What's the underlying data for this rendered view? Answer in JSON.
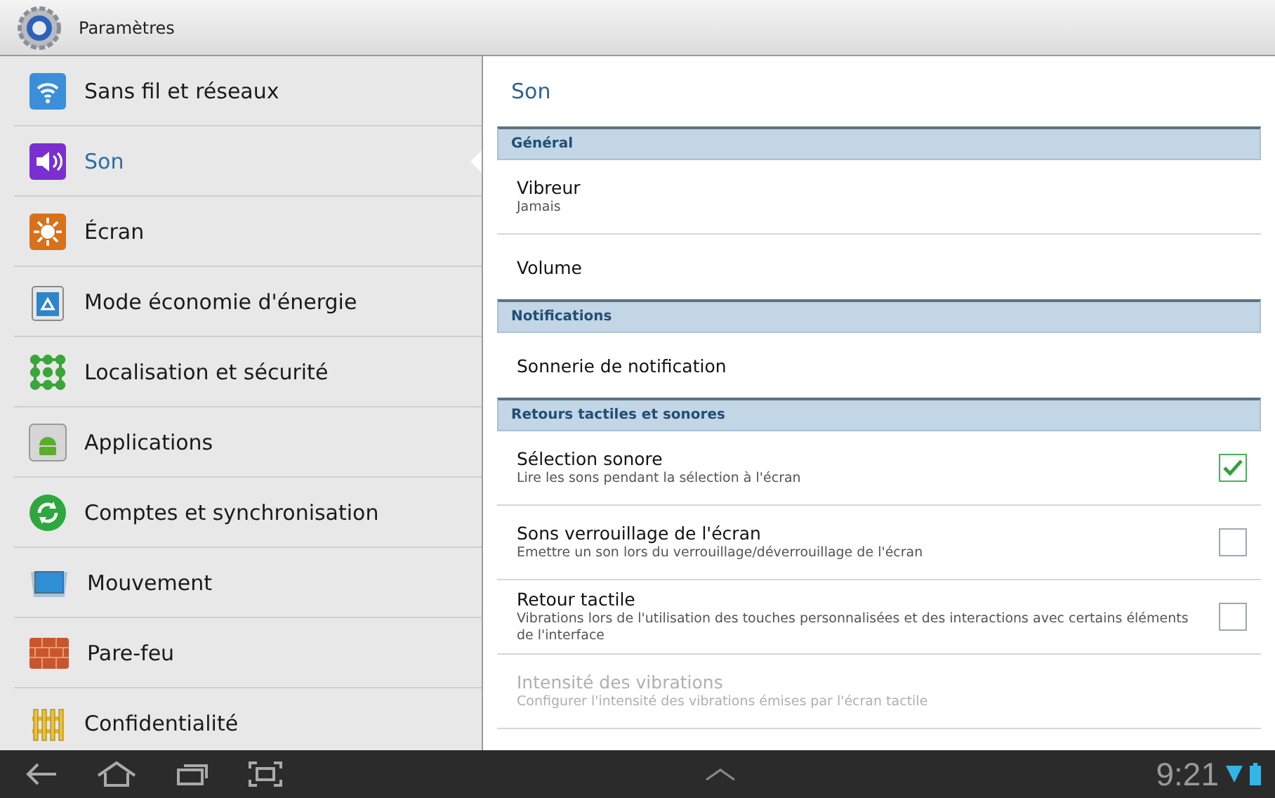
{
  "window": {
    "title": "Paramètres"
  },
  "sidebar": {
    "items": [
      {
        "label": "Sans fil et réseaux",
        "selected": false
      },
      {
        "label": "Son",
        "selected": true
      },
      {
        "label": "Écran",
        "selected": false
      },
      {
        "label": "Mode économie d'énergie",
        "selected": false
      },
      {
        "label": "Localisation et sécurité",
        "selected": false
      },
      {
        "label": "Applications",
        "selected": false
      },
      {
        "label": "Comptes et synchronisation",
        "selected": false
      },
      {
        "label": "Mouvement",
        "selected": false
      },
      {
        "label": "Pare-feu",
        "selected": false
      },
      {
        "label": "Confidentialité",
        "selected": false
      }
    ]
  },
  "panel": {
    "title": "Son",
    "sections": [
      {
        "header": "Général",
        "rows": [
          {
            "kind": "plain",
            "title": "Vibreur",
            "summary": "Jamais",
            "disabled": false
          },
          {
            "kind": "plain",
            "title": "Volume",
            "disabled": false
          }
        ]
      },
      {
        "header": "Notifications",
        "rows": [
          {
            "kind": "plain",
            "title": "Sonnerie de notification",
            "disabled": false
          }
        ]
      },
      {
        "header": "Retours tactiles et sonores",
        "rows": [
          {
            "kind": "checkbox",
            "title": "Sélection sonore",
            "summary": "Lire les sons pendant la sélection à l'écran",
            "checked": true,
            "disabled": false
          },
          {
            "kind": "checkbox",
            "title": "Sons verrouillage de l'écran",
            "summary": "Emettre un son lors du verrouillage/déverrouillage de l'écran",
            "checked": false,
            "disabled": false
          },
          {
            "kind": "checkbox",
            "title": "Retour tactile",
            "summary": "Vibrations lors de l'utilisation des touches personnalisées et des interactions avec certains éléments de l'interface",
            "checked": false,
            "disabled": false
          },
          {
            "kind": "plain",
            "title": "Intensité des vibrations",
            "summary": "Configurer l'intensité des vibrations émises par l'écran tactile",
            "disabled": true
          }
        ]
      }
    ]
  },
  "status_bar": {
    "time": "9:21"
  }
}
